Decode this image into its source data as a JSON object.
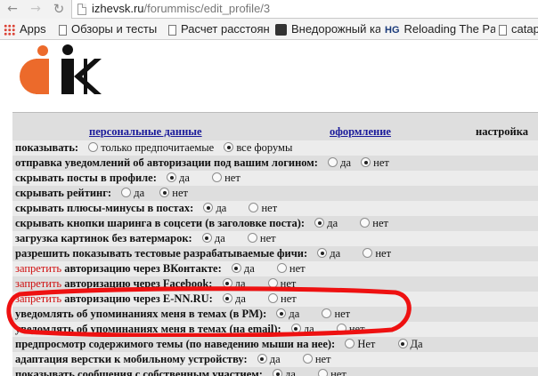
{
  "browser": {
    "url_host": "izhevsk.ru",
    "url_path": "/forummisc/edit_profile/3",
    "bookmarks": [
      {
        "label": "Apps",
        "icon": "apps-grid-icon"
      },
      {
        "label": "Обзоры и тесты",
        "icon": "page-icon"
      },
      {
        "label": "Расчет расстоян",
        "icon": "page-icon"
      },
      {
        "label": "Внедорожный ка",
        "icon": "offroad-icon"
      },
      {
        "label": "Reloading The Pa",
        "icon": "hg-icon"
      },
      {
        "label": "catap",
        "icon": "page-icon"
      }
    ],
    "hg_text": "HG"
  },
  "logo": {
    "colors": {
      "orange": "#ec6a2b",
      "black": "#111111"
    }
  },
  "tabs": {
    "personal": "персональные данные",
    "design": "оформление",
    "settings": "настройка"
  },
  "settings": [
    {
      "label": "показывать:",
      "options": [
        "только предпочитаемые",
        "все форумы"
      ],
      "selected": 1,
      "warn": ""
    },
    {
      "label": "отправка уведомлений об авторизации под вашим логином:",
      "options": [
        "да",
        "нет"
      ],
      "selected": 1,
      "warn": ""
    },
    {
      "label": "скрывать посты в профиле:",
      "options": [
        "да",
        "нет"
      ],
      "selected": 0,
      "warn": ""
    },
    {
      "label": "скрывать рейтинг:",
      "options": [
        "да",
        "нет"
      ],
      "selected": 1,
      "warn": ""
    },
    {
      "label": "скрывать плюсы-минусы в постах:",
      "options": [
        "да",
        "нет"
      ],
      "selected": 0,
      "warn": ""
    },
    {
      "label": "скрывать кнопки шаринга в соцсети (в заголовке поста):",
      "options": [
        "да",
        "нет"
      ],
      "selected": 0,
      "warn": ""
    },
    {
      "label": "загрузка картинок без ватермарок:",
      "options": [
        "да",
        "нет"
      ],
      "selected": 0,
      "warn": ""
    },
    {
      "label": "разрешить показывать тестовые разрабатываемые фичи:",
      "options": [
        "да",
        "нет"
      ],
      "selected": 0,
      "warn": ""
    },
    {
      "label": "авторизацию через ВКонтакте:",
      "options": [
        "да",
        "нет"
      ],
      "selected": 0,
      "warn": "запретить"
    },
    {
      "label": "авторизацию через Facebook:",
      "options": [
        "да",
        "нет"
      ],
      "selected": 0,
      "warn": "запретить"
    },
    {
      "label": "авторизацию через E-NN.RU:",
      "options": [
        "да",
        "нет"
      ],
      "selected": 0,
      "warn": "запретить"
    },
    {
      "label": "уведомлять об упоминаниях меня в темах (в PM):",
      "options": [
        "да",
        "нет"
      ],
      "selected": 0,
      "warn": ""
    },
    {
      "label": "уведомлять об упоминаниях меня в темах (на email):",
      "options": [
        "да",
        "нет"
      ],
      "selected": 0,
      "warn": ""
    },
    {
      "label": "предпросмотр содержимого темы (по наведению мыши на нее):",
      "options": [
        "Нет",
        "Да"
      ],
      "selected": 1,
      "warn": ""
    },
    {
      "label": "адаптация верстки к мобильному устройству:",
      "options": [
        "да",
        "нет"
      ],
      "selected": 0,
      "warn": ""
    },
    {
      "label": "показывать сообщения с собственным участием:",
      "options": [
        "да",
        "нет"
      ],
      "selected": 0,
      "warn": ""
    }
  ],
  "highlight_color": "#ee1111"
}
